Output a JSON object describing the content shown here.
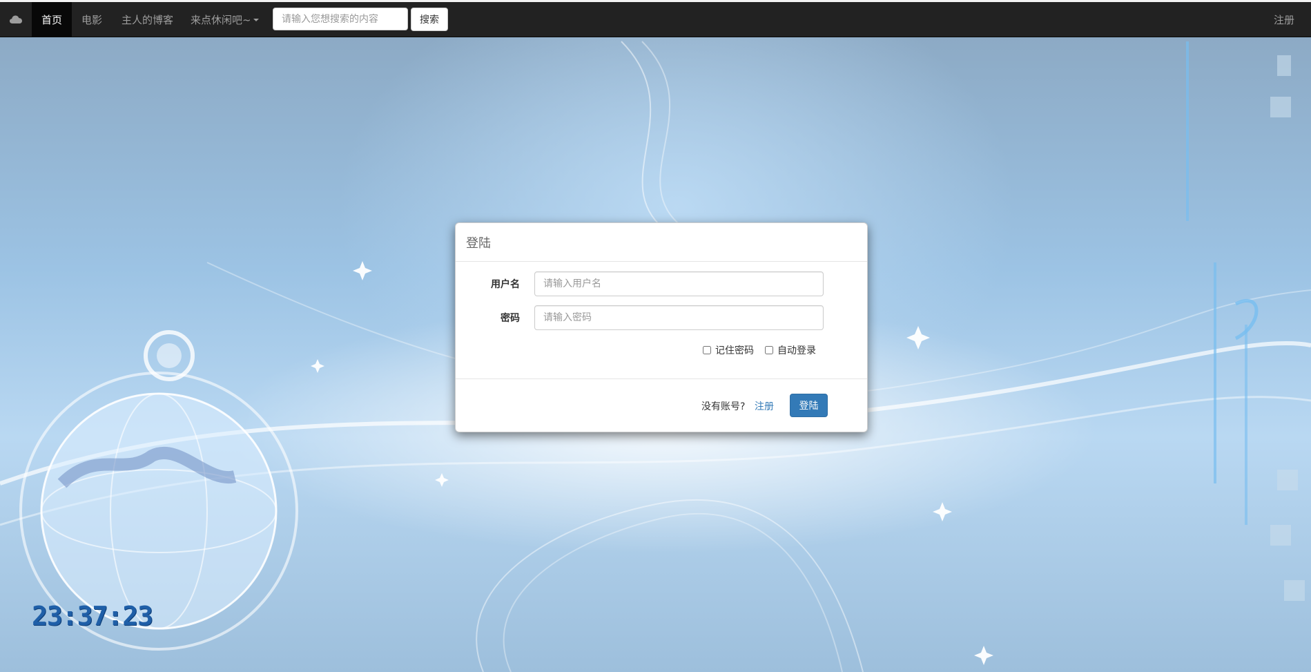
{
  "navbar": {
    "brand_icon": "cloud-icon",
    "items": [
      {
        "label": "首页",
        "active": true
      },
      {
        "label": "电影",
        "active": false
      },
      {
        "label": "主人的博客",
        "active": false
      },
      {
        "label": "来点休闲吧~",
        "active": false,
        "dropdown": true
      }
    ],
    "search": {
      "placeholder": "请输入您想搜索的内容",
      "value": "",
      "button_label": "搜索"
    },
    "register_label": "注册"
  },
  "login_modal": {
    "title": "登陆",
    "username": {
      "label": "用户名",
      "placeholder": "请输入用户名",
      "value": ""
    },
    "password": {
      "label": "密码",
      "placeholder": "请输入密码",
      "value": ""
    },
    "remember_label": "记住密码",
    "autologin_label": "自动登录",
    "no_account_text": "没有账号?",
    "register_link": "注册",
    "login_button": "登陆"
  },
  "clock": {
    "time": "23:37:23"
  },
  "colors": {
    "navbar_bg": "#222222",
    "accent": "#337ab7",
    "clock": "#1f5fa8"
  }
}
